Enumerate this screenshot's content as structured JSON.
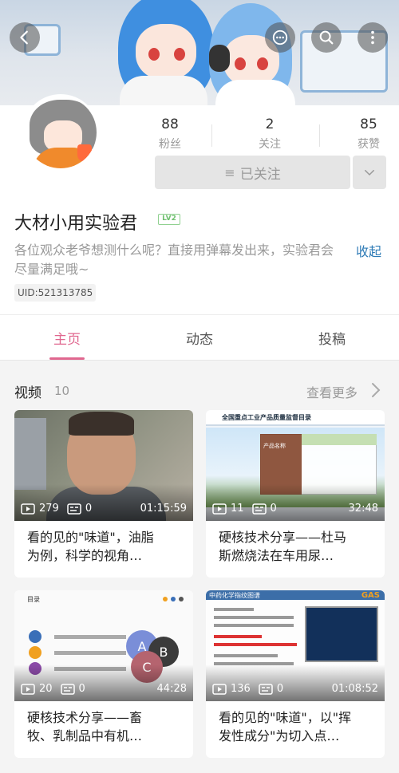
{
  "profile": {
    "name": "大材小用实验君",
    "level": "LV2",
    "bio": "各位观众老爷想测什么呢？直接用弹幕发出来，实验君会尽量满足哦~",
    "collapse_label": "收起",
    "uid": "UID:521313785"
  },
  "stats": {
    "followers": {
      "value": "88",
      "label": "粉丝"
    },
    "following": {
      "value": "2",
      "label": "关注"
    },
    "likes": {
      "value": "85",
      "label": "获赞"
    }
  },
  "follow_button": {
    "label": "已关注",
    "icon": "menu-lines-icon"
  },
  "tabs": [
    {
      "label": "主页"
    },
    {
      "label": "动态"
    },
    {
      "label": "投稿"
    }
  ],
  "videos_section": {
    "title": "视频",
    "count": "10",
    "more_label": "查看更多"
  },
  "videos": [
    {
      "plays": "279",
      "danmaku": "0",
      "duration": "01:15:59",
      "title_line1": "看的见的\"味道\"，油脂",
      "title_line2": "为例，科学的视角…"
    },
    {
      "plays": "11",
      "danmaku": "0",
      "duration": "32:48",
      "title_line1": "硬核技术分享——杜马",
      "title_line2": "斯燃烧法在车用尿…"
    },
    {
      "plays": "20",
      "danmaku": "0",
      "duration": "44:28",
      "title_line1": "硬核技术分享——畜",
      "title_line2": "牧、乳制品中有机…"
    },
    {
      "plays": "136",
      "danmaku": "0",
      "duration": "01:08:52",
      "title_line1": "看的见的\"味道\"，以\"挥",
      "title_line2": "发性成分\"为切入点…"
    }
  ],
  "thumb_text": {
    "v2_header": "全国重点工业产品质量监督目录",
    "v2_col": "产品名称",
    "v3_header": "目录",
    "v3_circle_a": "A",
    "v3_circle_b": "B",
    "v3_circle_c": "C",
    "v4_header": "中药化学指纹图谱",
    "v4_logo": "GAS"
  },
  "colors": {
    "accent": "#e0678f",
    "link": "#2e7bb6",
    "level_green": "#6fbf6f"
  }
}
